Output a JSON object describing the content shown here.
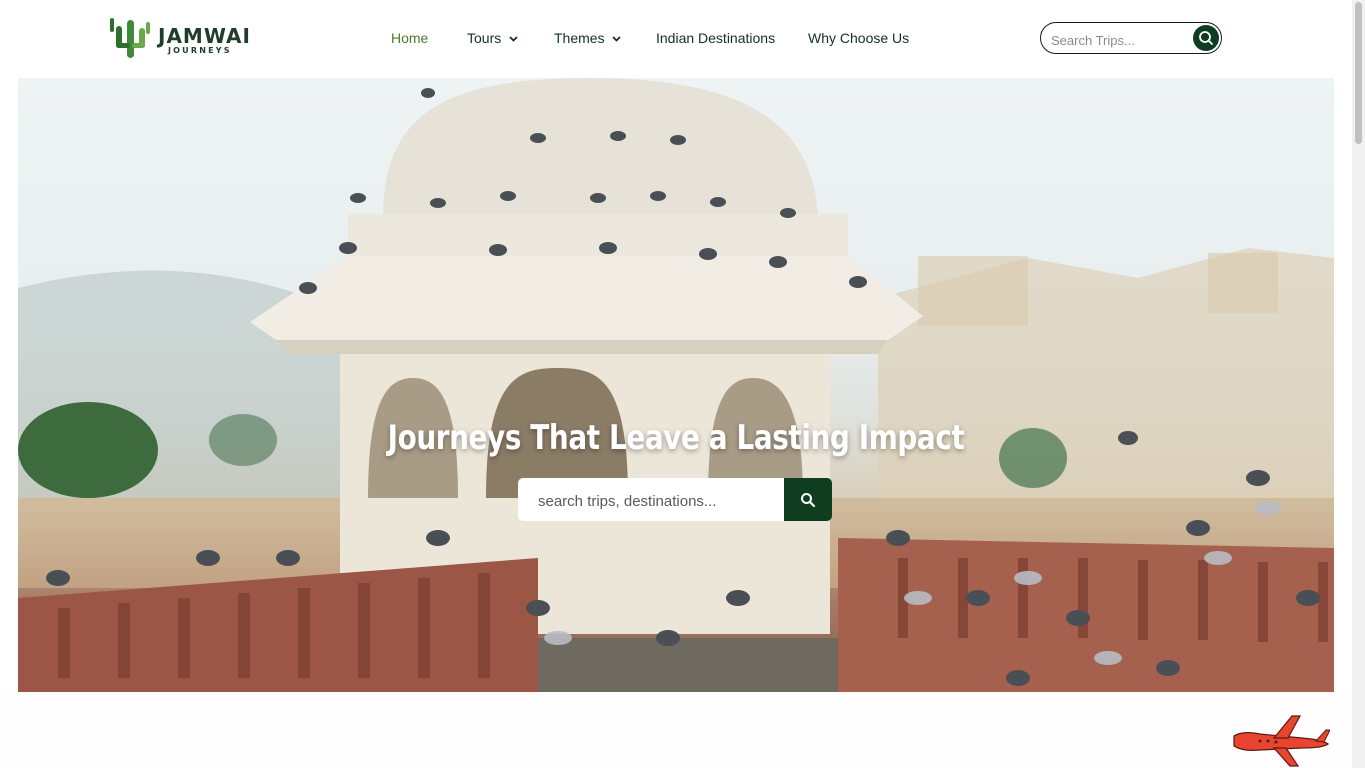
{
  "brand": {
    "name": "JAMWAI",
    "tagline": "JOURNEYS",
    "primary_color": "#0f3d1f",
    "active_nav_color": "#4d7a2a"
  },
  "nav": {
    "items": [
      {
        "label": "Home",
        "active": true,
        "has_dropdown": false
      },
      {
        "label": "Tours",
        "active": false,
        "has_dropdown": true
      },
      {
        "label": "Themes",
        "active": false,
        "has_dropdown": true
      },
      {
        "label": "Indian Destinations",
        "active": false,
        "has_dropdown": false
      },
      {
        "label": "Why Choose Us",
        "active": false,
        "has_dropdown": false
      }
    ]
  },
  "header_search": {
    "placeholder": "Search Trips...",
    "icon": "search-icon"
  },
  "hero": {
    "title": "Journeys That Leave a Lasting Impact",
    "search_placeholder": "search trips, destinations...",
    "search_icon": "search-icon"
  },
  "decor": {
    "plane_icon": "airplane-icon",
    "plane_color": "#e8442f"
  }
}
